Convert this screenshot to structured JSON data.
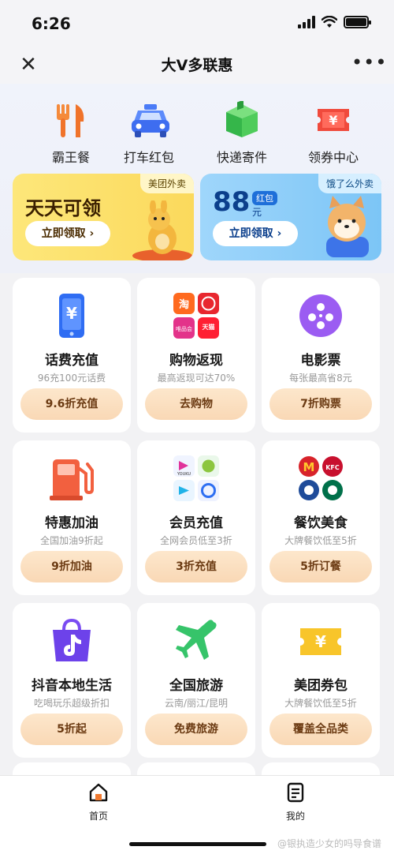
{
  "status_bar": {
    "time": "6:26"
  },
  "navbar": {
    "title": "大V多联惠",
    "more": "•••"
  },
  "quick_links": [
    {
      "label": "霸王餐",
      "icon": "fork-knife-icon"
    },
    {
      "label": "打车红包",
      "icon": "taxi-icon"
    },
    {
      "label": "快递寄件",
      "icon": "package-icon"
    },
    {
      "label": "领券中心",
      "icon": "coupon-icon"
    }
  ],
  "banners": {
    "left": {
      "tag": "美团外卖",
      "headline": "天天可领",
      "button": "立即领取 ›"
    },
    "right": {
      "tag": "饿了么外卖",
      "amount": "88",
      "unit": "元",
      "badge": "红包",
      "button": "立即领取 ›"
    }
  },
  "cards": [
    {
      "title": "话费充值",
      "subtitle": "96充100元话费",
      "button": "9.6折充值",
      "icon": "phone-yuan-icon"
    },
    {
      "title": "购物返现",
      "subtitle": "最高返现可达70%",
      "button": "去购物",
      "icon": "shopping-apps-icon",
      "apps": [
        "淘",
        "拼多多",
        "唯品会",
        "天猫"
      ]
    },
    {
      "title": "电影票",
      "subtitle": "每张最高省8元",
      "button": "7折购票",
      "icon": "film-reel-icon"
    },
    {
      "title": "特惠加油",
      "subtitle": "全国加油9折起",
      "button": "9折加油",
      "icon": "fuel-pump-icon"
    },
    {
      "title": "会员充值",
      "subtitle": "全网会员低至3折",
      "button": "3折充值",
      "icon": "membership-apps-icon",
      "apps": [
        "YOUKU"
      ]
    },
    {
      "title": "餐饮美食",
      "subtitle": "大牌餐饮低至5折",
      "button": "5折订餐",
      "icon": "food-brands-icon",
      "apps": [
        "M",
        "KFC"
      ]
    },
    {
      "title": "抖音本地生活",
      "subtitle": "吃喝玩乐超级折扣",
      "button": "5折起",
      "icon": "douyin-bag-icon"
    },
    {
      "title": "全国旅游",
      "subtitle": "云南/丽江/昆明",
      "button": "免费旅游",
      "icon": "airplane-icon"
    },
    {
      "title": "美团券包",
      "subtitle": "大牌餐饮低至5折",
      "button": "覆盖全品类",
      "icon": "voucher-icon"
    }
  ],
  "tabs": [
    {
      "label": "首页",
      "icon": "home-icon"
    },
    {
      "label": "我的",
      "icon": "profile-doc-icon"
    }
  ],
  "watermark": "@银执造少女的吗导食谱",
  "colors": {
    "accent": "#f07a30",
    "button_text": "#6b3a12",
    "button_bg": "#fbe0c2"
  }
}
